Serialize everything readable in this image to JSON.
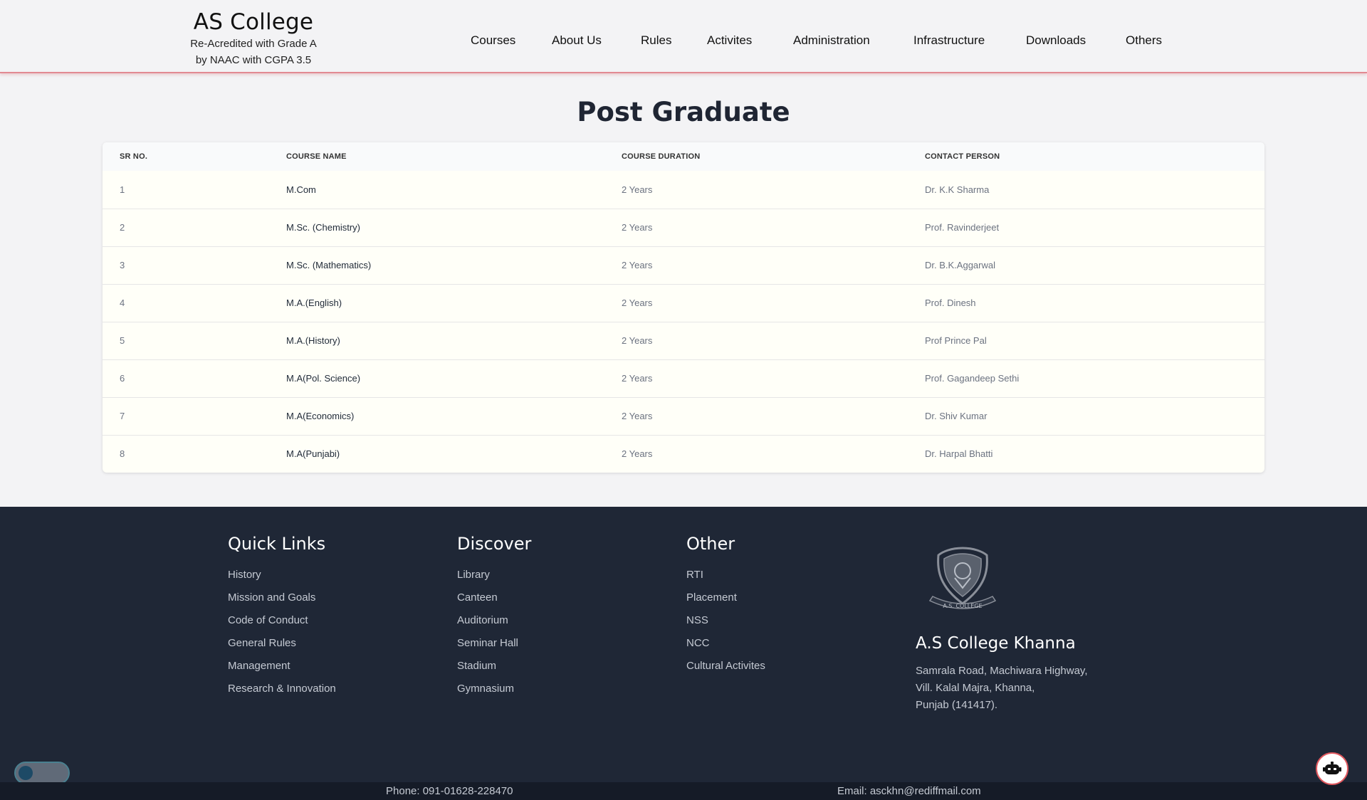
{
  "header": {
    "title": "AS College",
    "subtitle_line1": "Re-Acredited with Grade A",
    "subtitle_line2": "by NAAC with CGPA 3.5",
    "nav": [
      "Courses",
      "About Us",
      "Rules",
      "Activites",
      "Administration",
      "Infrastructure",
      "Downloads",
      "Others"
    ]
  },
  "main": {
    "title": "Post Graduate",
    "columns": [
      "SR NO.",
      "COURSE NAME",
      "COURSE DURATION",
      "CONTACT PERSON"
    ],
    "rows": [
      [
        "1",
        "M.Com",
        "2 Years",
        "Dr. K.K Sharma"
      ],
      [
        "2",
        "M.Sc. (Chemistry)",
        "2 Years",
        "Prof. Ravinderjeet"
      ],
      [
        "3",
        "M.Sc. (Mathematics)",
        "2 Years",
        "Dr. B.K.Aggarwal"
      ],
      [
        "4",
        "M.A.(English)",
        "2 Years",
        "Prof. Dinesh"
      ],
      [
        "5",
        "M.A.(History)",
        "2 Years",
        "Prof Prince Pal"
      ],
      [
        "6",
        "M.A(Pol. Science)",
        "2 Years",
        "Prof. Gagandeep Sethi"
      ],
      [
        "7",
        "M.A(Economics)",
        "2 Years",
        "Dr. Shiv Kumar"
      ],
      [
        "8",
        "M.A(Punjabi)",
        "2 Years",
        "Dr. Harpal Bhatti"
      ]
    ]
  },
  "footer": {
    "quick_links": {
      "title": "Quick Links",
      "items": [
        "History",
        "Mission and Goals",
        "Code of Conduct",
        "General Rules",
        "Management",
        "Research & Innovation"
      ]
    },
    "discover": {
      "title": "Discover",
      "items": [
        "Library",
        "Canteen",
        "Auditorium",
        "Seminar Hall",
        "Stadium",
        "Gymnasium"
      ]
    },
    "other": {
      "title": "Other",
      "items": [
        "RTI",
        "Placement",
        "NSS",
        "NCC",
        "Cultural Activites"
      ]
    },
    "contact": {
      "logo_text": "A.S. COLLEGE",
      "name": "A.S College Khanna",
      "address_line1": "Samrala Road, Machiwara Highway,",
      "address_line2": "Vill. Kalal Majra, Khanna,",
      "address_line3": "Punjab (141417)."
    },
    "phone": "Phone: 091-01628-228470",
    "email": "Email: asckhn@rediffmail.com"
  },
  "icons": {
    "theme_toggle": "toggle-switch",
    "chat_bot": "robot-icon"
  },
  "colors": {
    "footer_bg": "#1f2736",
    "header_border": "#e28a92",
    "bot_border": "#e0585e"
  }
}
